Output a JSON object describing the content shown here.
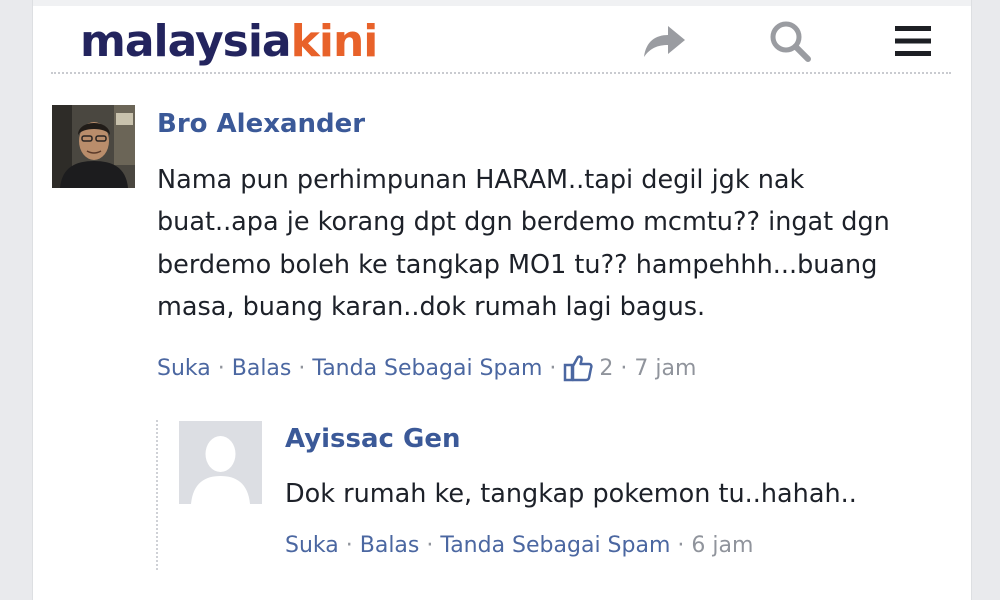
{
  "header": {
    "logo_part1": "malaysia",
    "logo_part2": "kini",
    "icons": [
      "share-icon",
      "search-icon",
      "menu-icon"
    ],
    "colors": {
      "logo_dark": "#23245e",
      "logo_accent": "#e8622a",
      "icon_gray": "#9a9ca1"
    }
  },
  "comments": [
    {
      "author": "Bro Alexander",
      "lines": [
        "Nama pun perhimpunan HARAM..tapi degil jgk nak",
        "buat..apa je korang dpt dgn berdemo mcmtu?? ingat dgn",
        "berdemo boleh ke tangkap MO1 tu?? hampehhh...buang",
        "masa, buang karan..dok rumah lagi bagus."
      ],
      "actions": {
        "like": "Suka",
        "reply": "Balas",
        "spam": "Tanda Sebagai Spam",
        "likes_count": "2",
        "time": "7 jam"
      },
      "replies": [
        {
          "author": "Ayissac Gen",
          "lines": [
            "Dok rumah ke, tangkap pokemon tu..hahah.."
          ],
          "actions": {
            "like": "Suka",
            "reply": "Balas",
            "spam": "Tanda Sebagai Spam",
            "time": "6 jam"
          }
        }
      ]
    }
  ],
  "colors": {
    "author": "#3b5998",
    "link": "#4b67a1",
    "meta": "#90949c",
    "text": "#1d2129"
  }
}
